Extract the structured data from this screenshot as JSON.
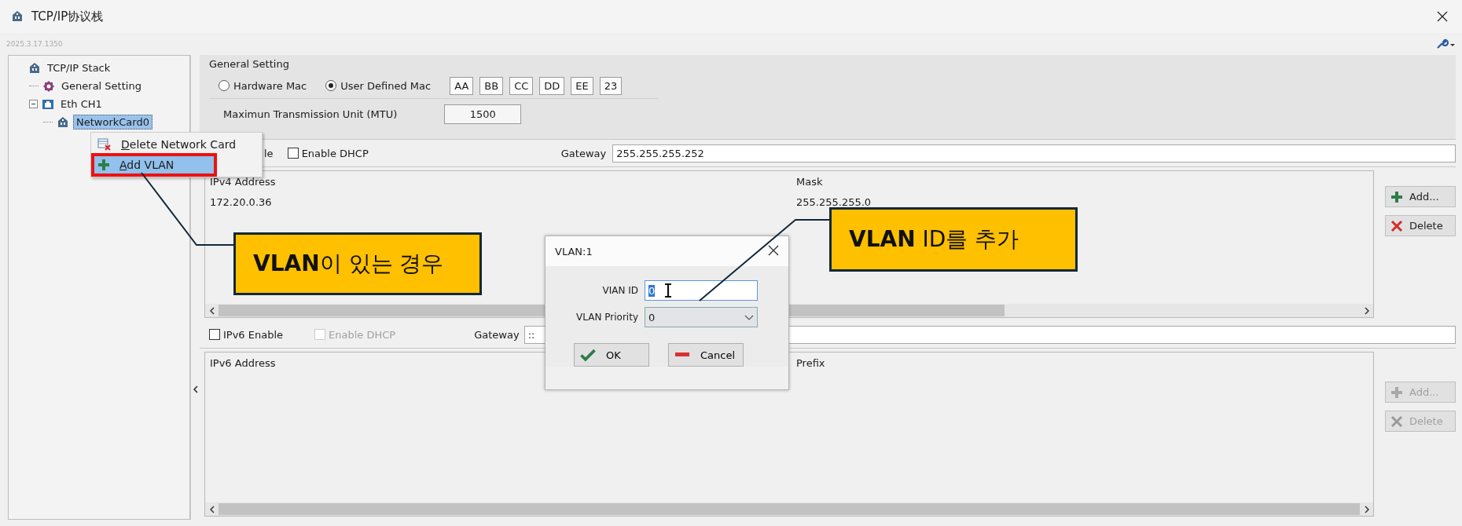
{
  "window": {
    "title": "TCP/IP协议栈",
    "version": "2025.3.17.1350"
  },
  "tree": [
    {
      "label": "TCP/IP Stack",
      "kind": "stack",
      "selected": false,
      "children": [
        {
          "label": "General Setting",
          "kind": "setting",
          "selected": false
        },
        {
          "label": "Eth CH1",
          "kind": "channel",
          "selected": false,
          "expanded": true,
          "children": [
            {
              "label": "NetworkCard0",
              "kind": "card",
              "selected": true
            }
          ]
        }
      ]
    }
  ],
  "general_setting": {
    "title": "General Setting",
    "mac_modes": [
      {
        "label": "Hardware Mac",
        "selected": false
      },
      {
        "label": "User Defined Mac",
        "selected": true
      }
    ],
    "mac_bytes": [
      "AA",
      "BB",
      "CC",
      "DD",
      "EE",
      "23"
    ],
    "mtu_label": "Maximun Transmission Unit (MTU)",
    "mtu": "1500"
  },
  "ipv4": {
    "enable_label": "le",
    "dhcp": {
      "label": "Enable DHCP",
      "checked": false,
      "disabled": false
    },
    "gateway_label": "Gateway",
    "gateway": "255.255.255.252",
    "columns": [
      "IPv4 Address",
      "Mask"
    ],
    "rows": [
      [
        "172.20.0.36",
        "255.255.255.0"
      ]
    ],
    "buttons": [
      {
        "label": "Add...",
        "kind": "add",
        "disabled": false
      },
      {
        "label": "Delete",
        "kind": "delete",
        "disabled": false
      }
    ]
  },
  "ipv6": {
    "enable": {
      "label": "IPv6 Enable",
      "checked": false,
      "disabled": false
    },
    "dhcp": {
      "label": "Enable DHCP",
      "checked": false,
      "disabled": true
    },
    "gateway_label": "Gateway",
    "gateway": "::",
    "columns": [
      "IPv6 Address",
      "Prefix"
    ],
    "buttons": [
      {
        "label": "Add...",
        "kind": "add",
        "disabled": true
      },
      {
        "label": "Delete",
        "kind": "delete",
        "disabled": true
      }
    ]
  },
  "context_menu": {
    "items": [
      {
        "label": "Delete Network Card",
        "kind": "delete-card",
        "selected": false,
        "marked": false
      },
      {
        "label": "Add VLAN",
        "kind": "add",
        "selected": true,
        "marked": true
      }
    ]
  },
  "dialog": {
    "title": "VLAN:1",
    "fields": [
      {
        "label": "VIAN ID",
        "kind": "text",
        "value": "0",
        "selected": true
      },
      {
        "label": "VLAN Priority",
        "kind": "select",
        "value": "0",
        "selected": false
      }
    ],
    "buttons": [
      {
        "label": "OK",
        "kind": "ok"
      },
      {
        "label": "Cancel",
        "kind": "cancel"
      }
    ]
  },
  "callouts": [
    {
      "text": "**VLAN**이 있는 경우"
    },
    {
      "text": "**VLAN** ID를 추가"
    }
  ]
}
